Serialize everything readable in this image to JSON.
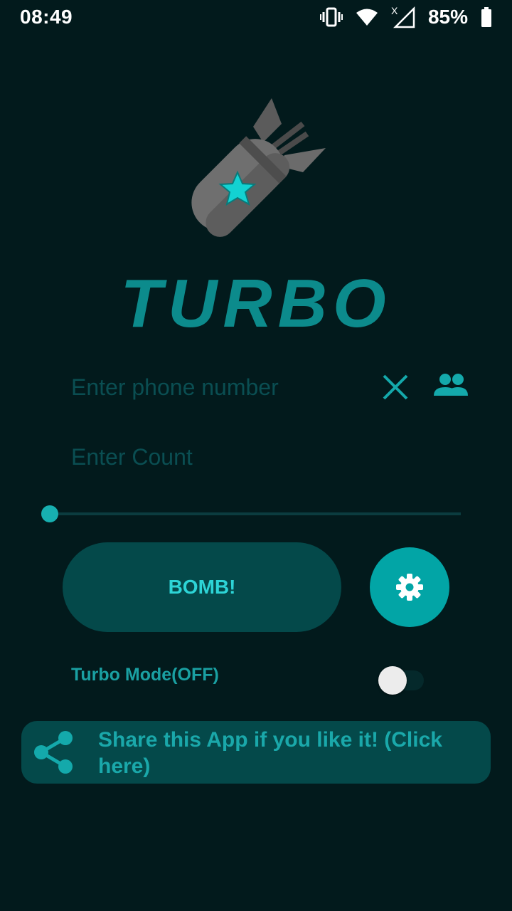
{
  "status_bar": {
    "time": "08:49",
    "battery": "85%",
    "network_x": "X"
  },
  "app": {
    "title": "TURBO"
  },
  "phone_input": {
    "placeholder": "Enter phone number",
    "value": ""
  },
  "count_input": {
    "placeholder": "Enter Count",
    "value": ""
  },
  "slider": {
    "value_fraction": 0.0
  },
  "actions": {
    "bomb_label": "BOMB!"
  },
  "turbo_mode": {
    "label": "Turbo Mode(OFF)",
    "enabled": false
  },
  "share": {
    "label": "Share this App if you like it! (Click here)"
  },
  "colors": {
    "background": "#021a1c",
    "accent": "#02a5a6",
    "button_dark": "#04494a",
    "title": "#0c8b8c"
  },
  "icons": {
    "clear": "close-icon",
    "contacts": "contacts-icon",
    "settings": "gear-icon",
    "share": "share-icon",
    "logo": "bomb-logo-icon"
  }
}
